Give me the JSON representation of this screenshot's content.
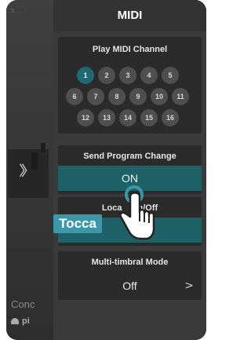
{
  "background_app": {
    "top_label": "s.. ·",
    "section_label": "Conc",
    "chip_label": "pi"
  },
  "panel": {
    "title": "MIDI",
    "play_midi_channel": {
      "title": "Play MIDI Channel",
      "channels": [
        "1",
        "2",
        "3",
        "4",
        "5",
        "6",
        "7",
        "8",
        "9",
        "10",
        "11",
        "12",
        "13",
        "14",
        "15",
        "16"
      ],
      "selected": "1"
    },
    "send_program_change": {
      "title": "Send Program Change",
      "value": "ON"
    },
    "local_on_off": {
      "title_left": "Loca",
      "title_right": "n/Off",
      "value": ""
    },
    "multi_timbral_mode": {
      "title": "Multi-timbral Mode",
      "value": "Off"
    }
  },
  "callout": {
    "label": "Tocca"
  },
  "colors": {
    "accent": "#1e6268",
    "selected_channel": "#1e6a74",
    "callout": "#3c97a8"
  }
}
